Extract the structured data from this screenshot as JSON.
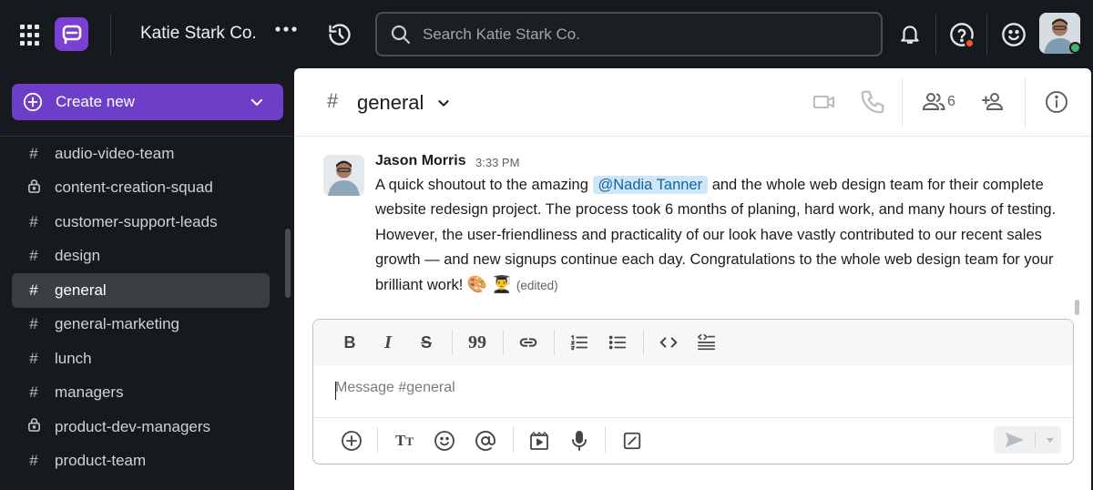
{
  "topbar": {
    "workspace_name": "Katie Stark Co.",
    "more_label": "•••",
    "search_placeholder": "Search Katie Stark Co.",
    "has_notification": true
  },
  "sidebar": {
    "create_label": "Create new",
    "channels": [
      {
        "name": "audio-video-team",
        "icon": "hash-icon",
        "private": false,
        "active": false
      },
      {
        "name": "content-creation-squad",
        "icon": "lock-icon",
        "private": true,
        "active": false
      },
      {
        "name": "customer-support-leads",
        "icon": "hash-icon",
        "private": false,
        "active": false
      },
      {
        "name": "design",
        "icon": "hash-icon",
        "private": false,
        "active": false
      },
      {
        "name": "general",
        "icon": "hash-icon",
        "private": false,
        "active": true
      },
      {
        "name": "general-marketing",
        "icon": "hash-icon",
        "private": false,
        "active": false
      },
      {
        "name": "lunch",
        "icon": "hash-icon",
        "private": false,
        "active": false
      },
      {
        "name": "managers",
        "icon": "hash-icon",
        "private": false,
        "active": false
      },
      {
        "name": "product-dev-managers",
        "icon": "lock-icon",
        "private": true,
        "active": false
      },
      {
        "name": "product-team",
        "icon": "hash-icon",
        "private": false,
        "active": false
      }
    ]
  },
  "channel_header": {
    "hash": "#",
    "name": "general",
    "member_count": "6"
  },
  "message": {
    "author": "Jason Morris",
    "time": "3:33 PM",
    "text_before": "A quick shoutout to the amazing ",
    "mention": "@Nadia Tanner",
    "text_after": " and the whole web design team for their complete website redesign project. The process took 6 months of planing, hard work, and many hours of testing. However, the user-friendliness and practicality of our look have vastly contributed to our recent sales growth — and new signups continue each day. Congratulations to the whole web design team for your brilliant work! ",
    "emoji_1": "🎨",
    "emoji_2": "👨‍🎓",
    "edited_label": "(edited)"
  },
  "composer": {
    "placeholder": "Message #general",
    "format_icons": [
      "bold-icon",
      "italic-icon",
      "strikethrough-icon",
      "quote-icon",
      "link-icon",
      "ordered-list-icon",
      "bullet-list-icon",
      "code-icon",
      "code-block-icon"
    ],
    "action_icons": [
      "plus-circle-icon",
      "text-format-icon",
      "emoji-icon",
      "mention-icon",
      "video-clip-icon",
      "microphone-icon",
      "slash-command-icon"
    ]
  },
  "colors": {
    "accent": "#6d3ec8",
    "logo": "#7b3fd6",
    "mention_bg": "#cfe6f7",
    "status_online": "#3bb56b",
    "notification": "#f05a28"
  }
}
